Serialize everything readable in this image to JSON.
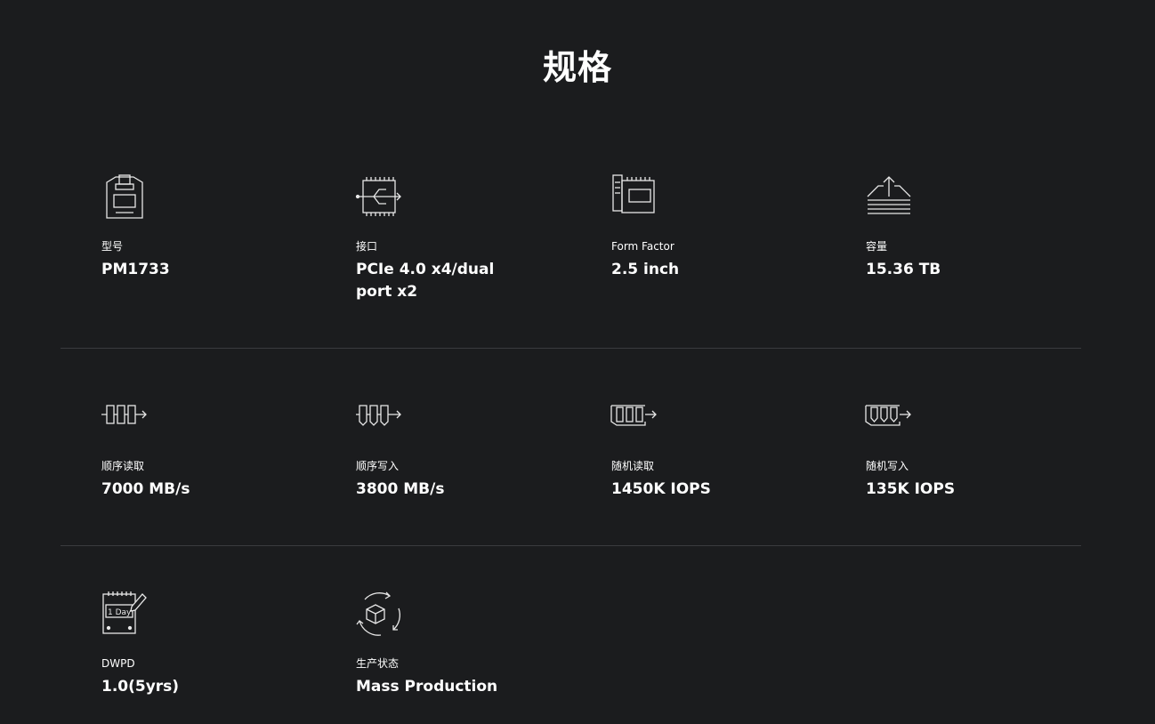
{
  "title": "规格",
  "rows": [
    [
      {
        "icon": "model-icon",
        "label": "型号",
        "value": "PM1733"
      },
      {
        "icon": "interface-icon",
        "label": "接口",
        "value": "PCIe 4.0 x4/dual port x2"
      },
      {
        "icon": "form-factor-icon",
        "label": "Form Factor",
        "value": "2.5 inch"
      },
      {
        "icon": "capacity-icon",
        "label": "容量",
        "value": "15.36 TB"
      }
    ],
    [
      {
        "icon": "sequential-read-icon",
        "label": "顺序读取",
        "value": "7000 MB/s"
      },
      {
        "icon": "sequential-write-icon",
        "label": "顺序写入",
        "value": "3800 MB/s"
      },
      {
        "icon": "random-read-icon",
        "label": "随机读取",
        "value": "1450K IOPS"
      },
      {
        "icon": "random-write-icon",
        "label": "随机写入",
        "value": "135K IOPS"
      }
    ],
    [
      {
        "icon": "dwpd-icon",
        "label": "DWPD",
        "value": "1.0(5yrs)",
        "icon_text": "1 Day"
      },
      {
        "icon": "production-status-icon",
        "label": "生产状态",
        "value": "Mass Production"
      }
    ]
  ],
  "colors": {
    "background": "#1b1c1e",
    "text": "#ffffff",
    "divider": "#3a3b3e"
  }
}
